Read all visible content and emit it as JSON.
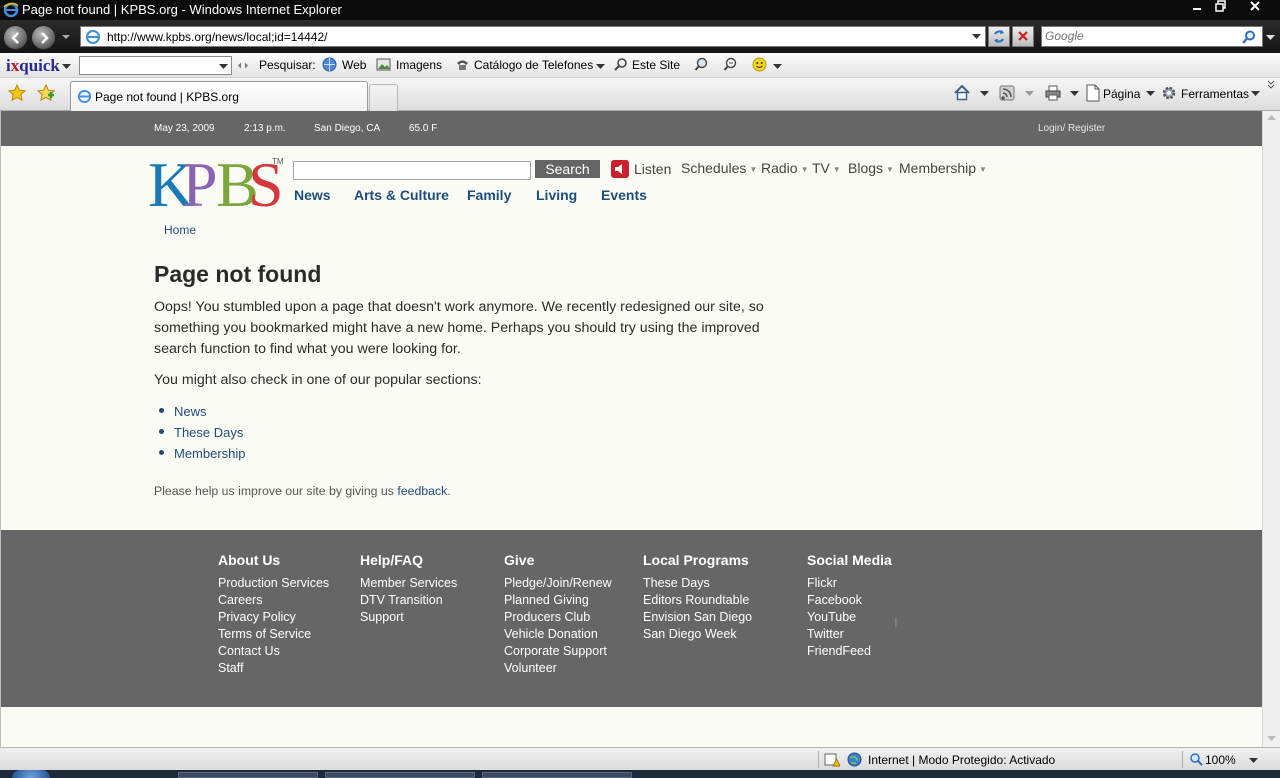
{
  "window": {
    "title": "Page not found | KPBS.org - Windows Internet Explorer"
  },
  "address_bar": {
    "url": "http://www.kpbs.org/news/local;id=14442/",
    "search_placeholder": "Google"
  },
  "toolbar": {
    "brand": "ixquick",
    "brand_x": "x",
    "brand_rest": "quick",
    "brand_first": "i",
    "search_label": "Pesquisar:",
    "web": "Web",
    "imagens": "Imagens",
    "catalogo": "Catálogo de Telefones",
    "este_site": "Este Site"
  },
  "tabs": {
    "active_title": "Page not found | KPBS.org",
    "pagina": "Página",
    "ferramentas": "Ferramentas"
  },
  "page": {
    "topbar": {
      "date": "May 23, 2009",
      "time": "2:13 p.m.",
      "location": "San Diego, CA",
      "temp": "65.0 F",
      "login": "Login/ Register"
    },
    "search_button": "Search",
    "listen": "Listen",
    "top_nav": [
      "Schedules",
      "Radio",
      "TV",
      "Blogs",
      "Membership"
    ],
    "main_nav": [
      "News",
      "Arts & Culture",
      "Family",
      "Living",
      "Events"
    ],
    "breadcrumb": "Home",
    "heading": "Page not found",
    "paragraph1": "Oops! You stumbled upon a page that doesn't work anymore. We recently redesigned our site, so something you bookmarked might have a new home. Perhaps you should try using the improved search function to find what you were looking for.",
    "paragraph2": "You might also check in one of our popular sections:",
    "sections": [
      "News",
      "These Days",
      "Membership"
    ],
    "feedback_prefix": "Please help us improve our site by giving us ",
    "feedback_link": "feedback",
    "feedback_suffix": ".",
    "footer": {
      "columns": [
        {
          "heading": "About Us",
          "links": [
            "Production Services",
            "Careers",
            "Privacy Policy",
            "Terms of Service",
            "Contact Us",
            "Staff"
          ]
        },
        {
          "heading": "Help/FAQ",
          "links": [
            "Member Services",
            "DTV Transition",
            "Support"
          ]
        },
        {
          "heading": "Give",
          "links": [
            "Pledge/Join/Renew",
            "Planned Giving",
            "Producers Club",
            "Vehicle Donation",
            "Corporate Support",
            "Volunteer"
          ]
        },
        {
          "heading": "Local Programs",
          "links": [
            "These Days",
            "Editors Roundtable",
            "Envision San Diego",
            "San Diego Week"
          ]
        },
        {
          "heading": "Social Media",
          "links": [
            "Flickr",
            "Facebook",
            "YouTube",
            "Twitter",
            "FriendFeed"
          ]
        }
      ]
    }
  },
  "status_bar": {
    "zone": "Internet | Modo Protegido: Activado",
    "zoom": "100%"
  },
  "colors": {
    "kpbs_gray": "#666666",
    "link_blue": "#1f4d7a",
    "page_bg": "#fcfcf6"
  }
}
